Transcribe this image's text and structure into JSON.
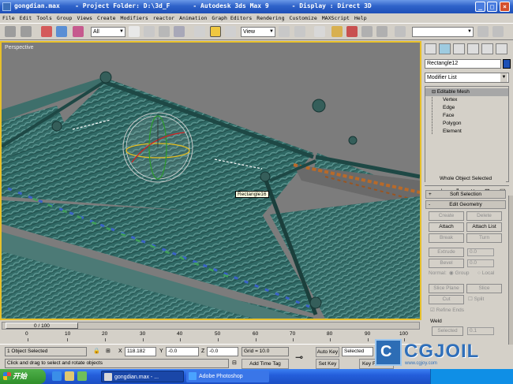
{
  "window": {
    "title": "gongdian.max    - Project Folder: D:\\3d_F      - Autodesk 3ds Max 9      - Display : Direct 3D",
    "minimize_icon": "minimize-icon",
    "maximize_icon": "maximize-icon",
    "close_icon": "close-icon"
  },
  "menu": {
    "items": [
      "File",
      "Edit",
      "Tools",
      "Group",
      "Views",
      "Create",
      "Modifiers",
      "reactor",
      "Animation",
      "Graph Editors",
      "Rendering",
      "Customize",
      "MAXScript",
      "Help"
    ]
  },
  "toolbar": {
    "selection_filter": "All",
    "reference_coord": "View",
    "named_selection": ""
  },
  "viewport": {
    "label": "Perspective",
    "object_tooltip": "Rectangle16"
  },
  "command_panel": {
    "object_name": "Rectangle12",
    "object_color": "#1b4fb5",
    "modifier_list": "Modifier List",
    "stack": {
      "base": "Editable Mesh",
      "sub": [
        "Vertex",
        "Edge",
        "Face",
        "Polygon",
        "Element"
      ]
    },
    "selection_status": "Whole Object Selected",
    "rollouts": {
      "soft_selection": "Soft Selection",
      "edit_geometry": "Edit Geometry"
    },
    "edit_geometry": {
      "create": "Create",
      "delete": "Delete",
      "attach": "Attach",
      "attach_list": "Attach List",
      "break": "Break",
      "turn": "Turn",
      "extrude": "Extrude",
      "extrude_value": "0.0",
      "bevel": "Bevel",
      "bevel_value": "0.0",
      "normal_label": "Normal:",
      "group": "Group",
      "local": "Local",
      "slice_plane": "Slice Plane",
      "slice": "Slice",
      "cut": "Cut",
      "split": "Split",
      "refine_ends": "Refine Ends",
      "weld": "Weld",
      "selected": "Selected",
      "selected_value": "0.1"
    }
  },
  "timeline": {
    "frame": "0 / 100",
    "ticks": [
      "0",
      "10",
      "20",
      "30",
      "40",
      "50",
      "60",
      "70",
      "80",
      "90",
      "100"
    ]
  },
  "status": {
    "selection": "1 Object Selected",
    "prompt": "Click and drag to select and rotate objects",
    "x_label": "X",
    "x": "118.182",
    "y_label": "Y",
    "y": "-0.0",
    "z_label": "Z",
    "z": "-0.0",
    "grid": "Grid = 10.0",
    "add_time_tag": "Add Time Tag",
    "auto_key": "Auto Key",
    "set_key": "Set Key",
    "key_mode": "Selected",
    "key_filters": "Key Filters..."
  },
  "watermark": {
    "logo_letter": "C",
    "text": "CGJOIL",
    "url": "www.cgjoy.com"
  },
  "taskbar": {
    "start": "开始",
    "items": [
      {
        "label": "gongdian.max - ...",
        "color": "#d8d8d8"
      },
      {
        "label": "Adobe Photoshop",
        "color": "#4aa3ff"
      }
    ]
  }
}
